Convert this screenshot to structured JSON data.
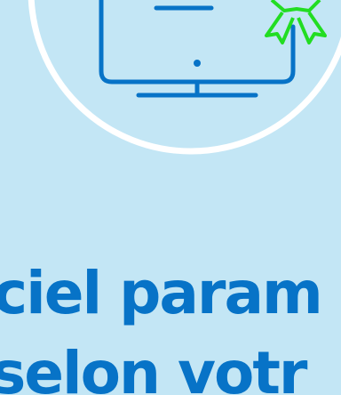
{
  "headline": {
    "line1": "ciel param",
    "line2": "selon votr"
  },
  "colors": {
    "background": "#c3e6f5",
    "circle_fill": "#c3e6f5",
    "circle_stroke": "#ffffff",
    "monitor": "#0773c7",
    "badge": "#22dd22",
    "headline": "#0773c7"
  },
  "icons": {
    "monitor": "monitor-icon",
    "badge": "award-ribbon-icon"
  }
}
